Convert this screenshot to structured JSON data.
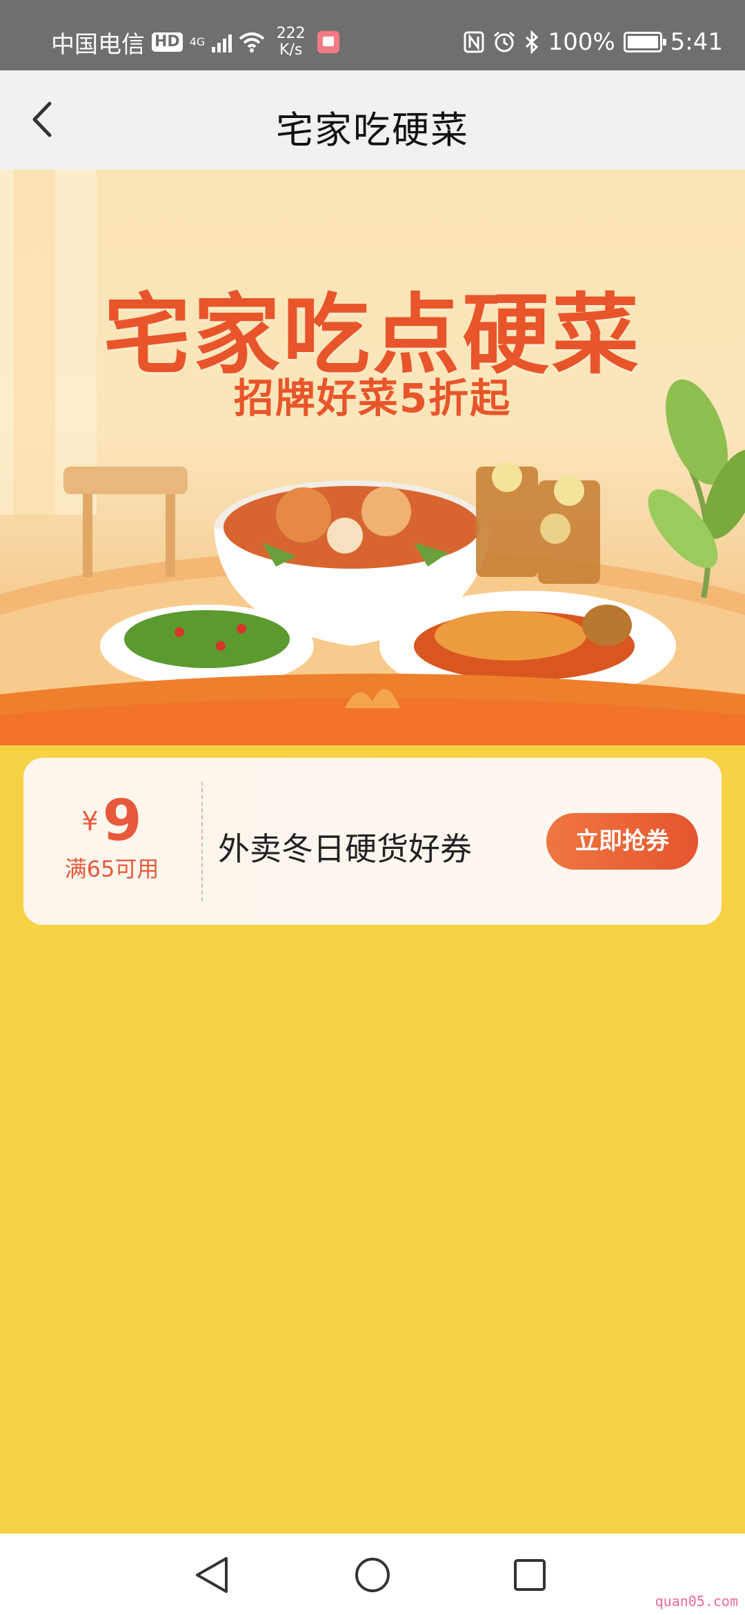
{
  "status_bar": {
    "carrier": "中国电信",
    "hd_badge": "HD",
    "network": "4G",
    "speed_value": "222",
    "speed_unit": "K/s",
    "battery": "100%",
    "time": "5:41"
  },
  "nav": {
    "title": "宅家吃硬菜"
  },
  "banner": {
    "title": "宅家吃点硬菜",
    "subtitle": "招牌好菜5折起"
  },
  "coupon": {
    "currency": "¥",
    "amount": "9",
    "condition": "满65可用",
    "name": "外卖冬日硬货好券",
    "button_label": "立即抢券"
  },
  "watermark": "quan05.com",
  "colors": {
    "page_background": "#f7d245",
    "accent": "#e7593a",
    "status_bar": "#6f6f6f",
    "nav_bar": "#f1f1f1"
  }
}
